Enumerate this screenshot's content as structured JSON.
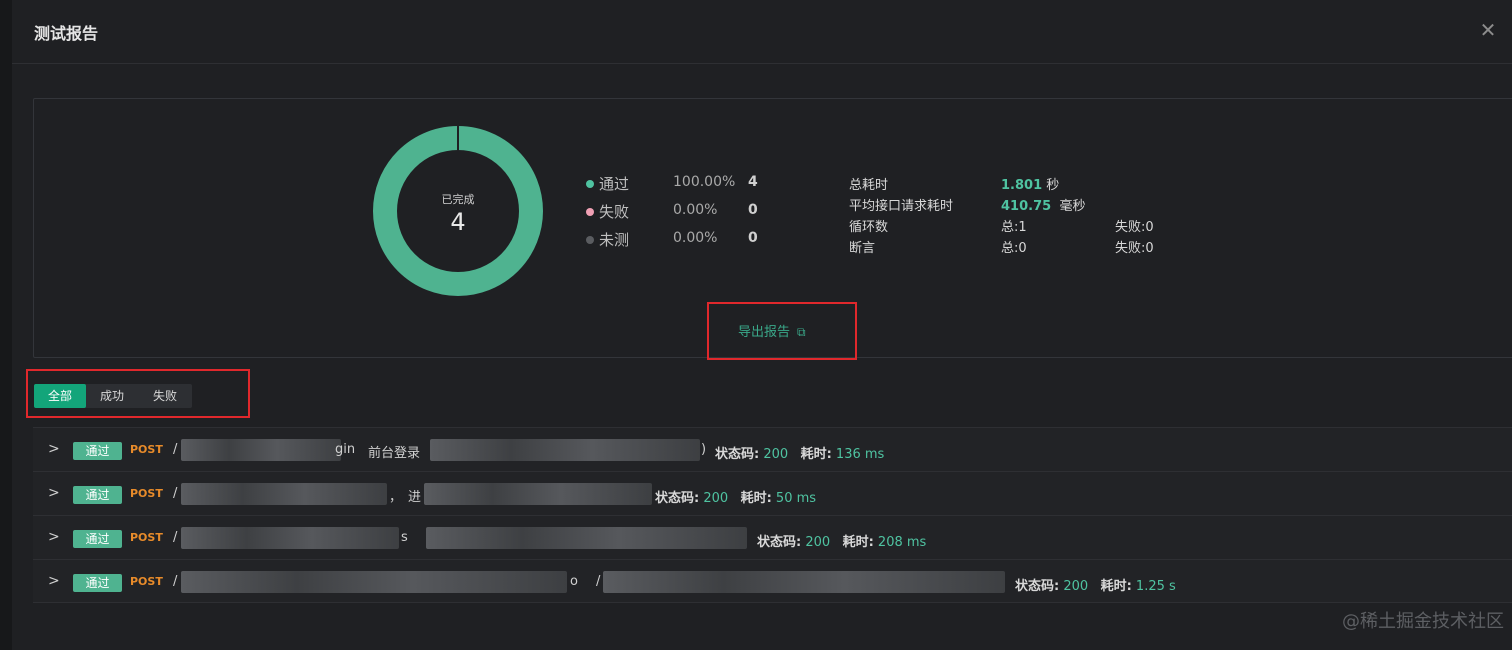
{
  "dialog": {
    "title": "测试报告",
    "close_icon": "close-icon"
  },
  "summary": {
    "donut": {
      "label": "已完成",
      "value": "4",
      "pass_fraction": 1.0,
      "color": "#4fb390"
    },
    "legend": [
      {
        "name": "通过",
        "percent": "100.00%",
        "count": "4",
        "color": "#4fc3a1"
      },
      {
        "name": "失败",
        "percent": "0.00%",
        "count": "0",
        "color": "#f0a0b4"
      },
      {
        "name": "未测",
        "percent": "0.00%",
        "count": "0",
        "color": "#5a5c60"
      }
    ],
    "stats": {
      "total_time_label": "总耗时",
      "total_time_value": "1.801",
      "total_time_unit": "秒",
      "avg_time_label": "平均接口请求耗时",
      "avg_time_value": "410.75",
      "avg_time_unit": "毫秒",
      "loops_label": "循环数",
      "loops_total": "总:1",
      "loops_failed": "失败:0",
      "assert_label": "断言",
      "assert_total": "总:0",
      "assert_failed": "失败:0"
    },
    "export_label": "导出报告",
    "export_icon": "external-link-icon"
  },
  "filters": {
    "tabs": [
      "全部",
      "成功",
      "失败"
    ],
    "active": "全部"
  },
  "results": [
    {
      "status": "通过",
      "method": "POST",
      "path_prefix": "/",
      "path_suffix": "gin",
      "desc": "前台登录",
      "desc_tail": ")",
      "code_label": "状态码:",
      "code": "200",
      "time_label": "耗时:",
      "time": "136 ms"
    },
    {
      "status": "通过",
      "method": "POST",
      "path_prefix": "/",
      "path_suffix": "，",
      "desc": "进",
      "desc_tail": "",
      "code_label": "状态码:",
      "code": "200",
      "time_label": "耗时:",
      "time": "50 ms"
    },
    {
      "status": "通过",
      "method": "POST",
      "path_prefix": "/",
      "path_suffix": "s",
      "desc": "",
      "desc_tail": "",
      "code_label": "状态码:",
      "code": "200",
      "time_label": "耗时:",
      "time": "208 ms"
    },
    {
      "status": "通过",
      "method": "POST",
      "path_prefix": "/",
      "path_suffix": "o",
      "desc": "/",
      "desc_tail": "",
      "code_label": "状态码:",
      "code": "200",
      "time_label": "耗时:",
      "time": "1.25 s"
    }
  ],
  "watermark": "@稀土掘金技术社区"
}
